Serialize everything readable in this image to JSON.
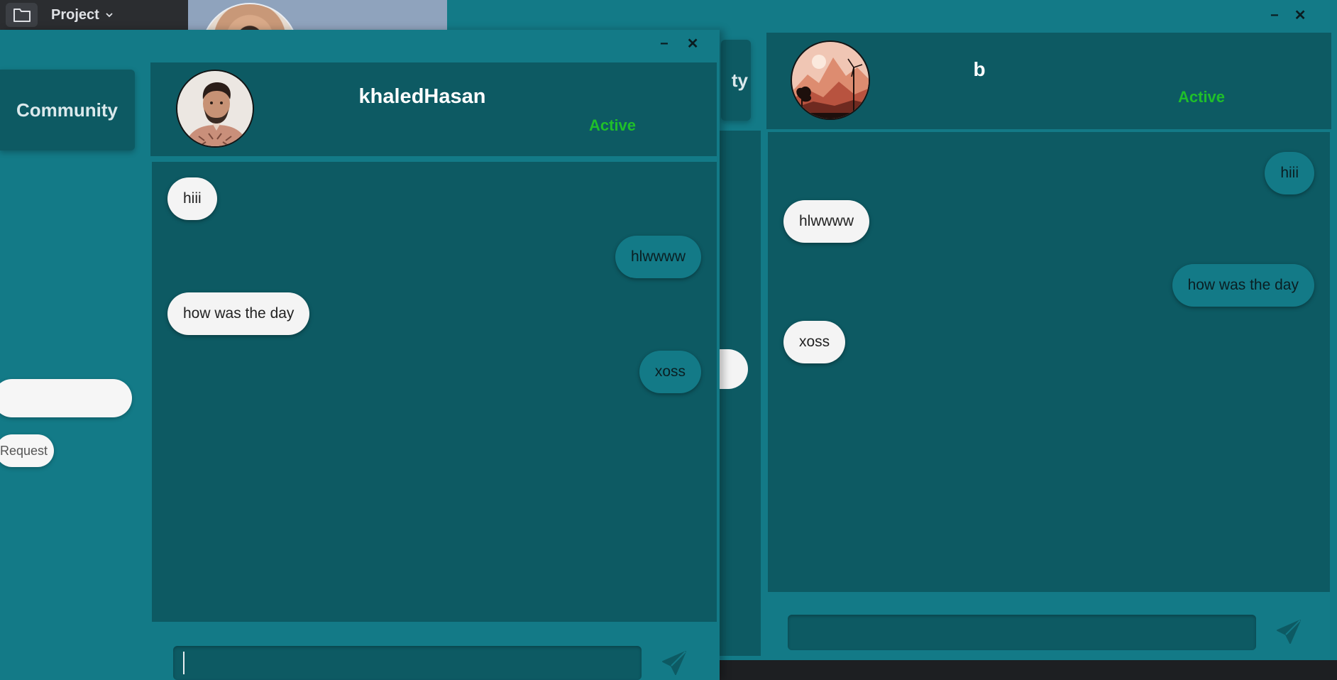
{
  "ide": {
    "project_label": "Project",
    "icons": {
      "folder": "folder-icon",
      "chevron": "chevron-down-icon"
    }
  },
  "front_window": {
    "nav_tab_label": "Community",
    "request_button_label": "Request",
    "chat": {
      "username": "khaledHasan",
      "status": "Active",
      "messages": [
        {
          "text": "hiii",
          "side": "left"
        },
        {
          "text": "hlwwww",
          "side": "right"
        },
        {
          "text": "how was the day",
          "side": "left"
        },
        {
          "text": "xoss",
          "side": "right"
        }
      ],
      "input_value": ""
    },
    "controls": {
      "minimize": "−",
      "close": "✕"
    }
  },
  "back_window": {
    "nav_tab_label_partial": "ty",
    "chat": {
      "username": "b",
      "status": "Active",
      "messages": [
        {
          "text": "hiii",
          "side": "right"
        },
        {
          "text": "hlwwww",
          "side": "left"
        },
        {
          "text": "how was the day",
          "side": "right"
        },
        {
          "text": "xoss",
          "side": "left"
        }
      ],
      "input_value": ""
    },
    "controls": {
      "minimize": "−",
      "close": "✕"
    }
  },
  "colors": {
    "teal_dark": "#0d5a63",
    "teal": "#137a87",
    "status_green": "#1fbf2a",
    "bubble_light": "#f4f4f4",
    "ide_bar": "#2b2d30"
  }
}
